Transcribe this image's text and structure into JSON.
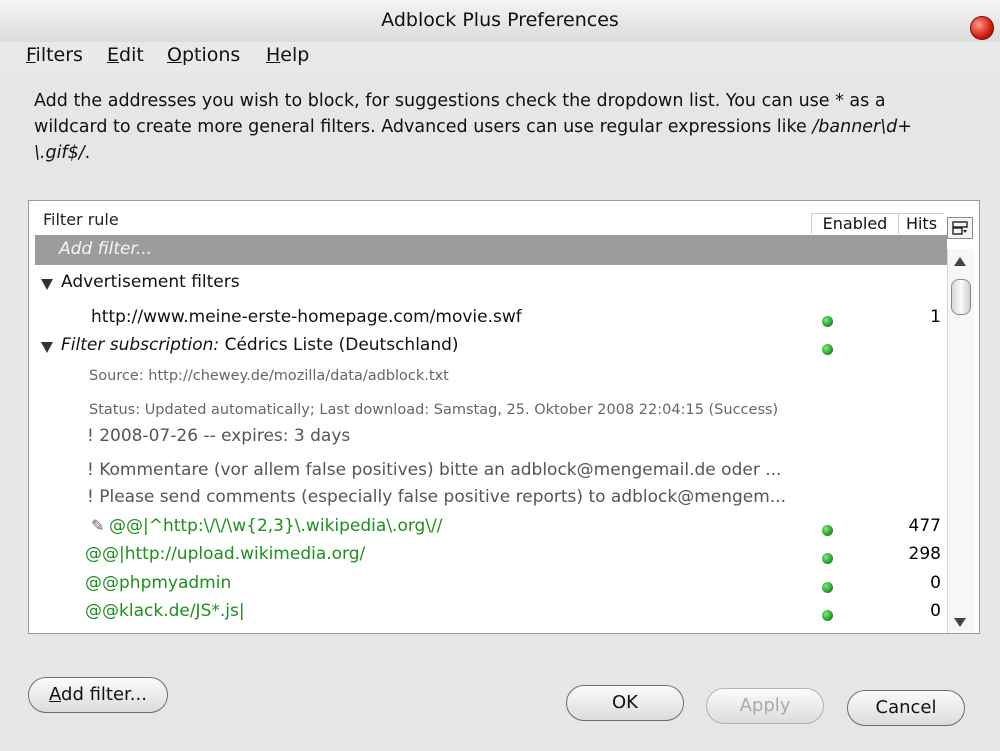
{
  "window": {
    "title": "Adblock Plus Preferences"
  },
  "menu": [
    {
      "label": "Filters",
      "accel": "F",
      "rest": "ilters"
    },
    {
      "label": "Edit",
      "accel": "E",
      "rest": "dit"
    },
    {
      "label": "Options",
      "accel": "O",
      "rest": "ptions"
    },
    {
      "label": "Help",
      "accel": "H",
      "rest": "elp"
    }
  ],
  "description": {
    "line1": "Add the addresses you wish to block, for suggestions check the dropdown list. You can use * as a",
    "line2": "wildcard to create more general filters. Advanced users can use regular expressions like ",
    "regex_a": "/banner\\d+",
    "regex_b": "\\.gif$/",
    "suffix": "."
  },
  "columns": {
    "rule": "Filter rule",
    "enabled": "Enabled",
    "hits": "Hits"
  },
  "add_filter_placeholder": "Add filter...",
  "rows": [
    {
      "kind": "group",
      "text": "Advertisement filters"
    },
    {
      "kind": "rule",
      "text": "http://www.meine-erste-homepage.com/movie.swf",
      "enabled": true,
      "hits": "1"
    },
    {
      "kind": "group",
      "prefix": "Filter subscription:",
      "text": " Cédrics Liste (Deutschland)",
      "enabled": true
    },
    {
      "kind": "meta",
      "text": "Source: http://chewey.de/mozilla/data/adblock.txt"
    },
    {
      "kind": "meta",
      "text": "Status: Updated automatically; Last download: Samstag, 25. Oktober 2008 22:04:15 (Success)"
    },
    {
      "kind": "comment",
      "text": "! 2008-07-26 -- expires: 3 days"
    },
    {
      "kind": "comment",
      "text": "! Kommentare (vor allem false positives) bitte an adblock@mengemail.de oder ..."
    },
    {
      "kind": "comment",
      "text": "! Please send comments (especially false positive reports) to adblock@mengem..."
    },
    {
      "kind": "exception",
      "pin": true,
      "text": "@@|^http:\\/\\/\\w{2,3}\\.wikipedia\\.org\\//",
      "enabled": true,
      "hits": "477"
    },
    {
      "kind": "exception",
      "text": "@@|http://upload.wikimedia.org/",
      "enabled": true,
      "hits": "298"
    },
    {
      "kind": "exception",
      "text": "@@phpmyadmin",
      "enabled": true,
      "hits": "0"
    },
    {
      "kind": "exception",
      "text": "@@klack.de/JS*.js|",
      "enabled": true,
      "hits": "0"
    }
  ],
  "buttons": {
    "add_filter": {
      "label": "Add filter...",
      "accel": "A",
      "rest": "dd filter..."
    },
    "ok": "OK",
    "apply": "Apply",
    "cancel": "Cancel"
  },
  "colors": {
    "enabled_dot": "#1f9a1f",
    "exception_text": "#1d8f1d",
    "close": "#d11d10"
  },
  "icons": [
    "close-icon",
    "column-picker-icon",
    "twisty-down-icon",
    "scroll-up-icon",
    "scroll-down-icon",
    "pin-icon",
    "enabled-dot-icon"
  ]
}
